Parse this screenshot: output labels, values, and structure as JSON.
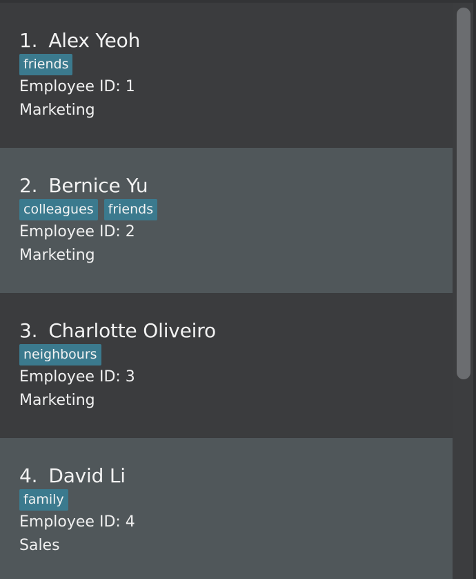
{
  "employees": [
    {
      "index": "1.",
      "name": "Alex Yeoh",
      "tags": [
        "friends"
      ],
      "employee_id": "Employee ID: 1",
      "department": "Marketing"
    },
    {
      "index": "2.",
      "name": "Bernice Yu",
      "tags": [
        "colleagues",
        "friends"
      ],
      "employee_id": "Employee ID: 2",
      "department": "Marketing"
    },
    {
      "index": "3.",
      "name": "Charlotte Oliveiro",
      "tags": [
        "neighbours"
      ],
      "employee_id": "Employee ID: 3",
      "department": "Marketing"
    },
    {
      "index": "4.",
      "name": "David Li",
      "tags": [
        "family"
      ],
      "employee_id": "Employee ID: 4",
      "department": "Sales"
    }
  ],
  "colors": {
    "card_dark": "#3b3c3e",
    "card_light": "#50575a",
    "tag_bg": "#3b7a8e",
    "text": "#f2f2f2",
    "scroll_thumb": "#6b6d70"
  }
}
